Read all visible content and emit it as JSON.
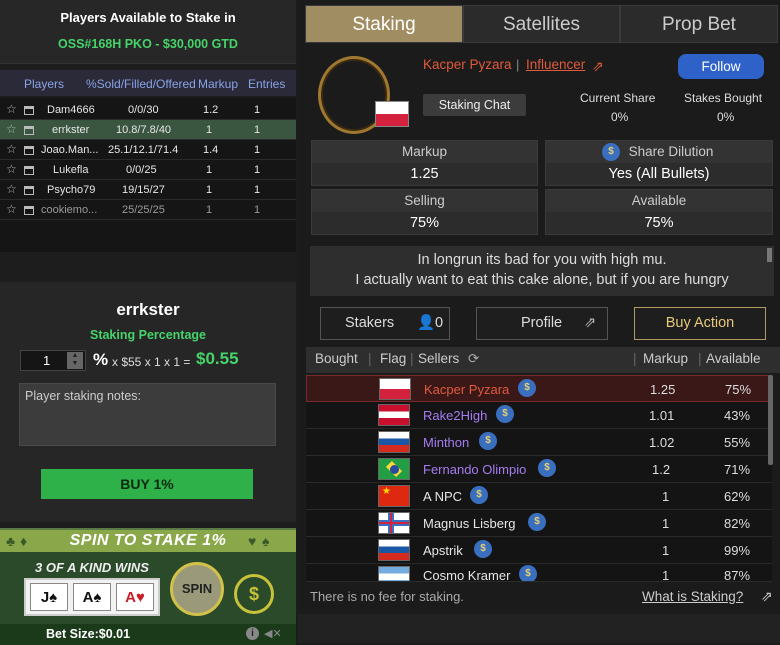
{
  "left_panel": {
    "title": "Players Available to Stake in",
    "subtitle": "OSS#168H PKO - $30,000 GTD",
    "columns": [
      "Players",
      "%Sold/Filled/Offered",
      "Markup",
      "Entries"
    ],
    "rows": [
      {
        "player": "Dam4666",
        "sold": "0/0/30",
        "markup": "1.2",
        "entries": "1"
      },
      {
        "player": "errkster",
        "sold": "10.8/7.8/40",
        "markup": "1",
        "entries": "1"
      },
      {
        "player": "Joao.Man...",
        "sold": "25.1/12.1/71.4",
        "markup": "1.4",
        "entries": "1"
      },
      {
        "player": "Lukefla",
        "sold": "0/0/25",
        "markup": "1",
        "entries": "1"
      },
      {
        "player": "Psycho79",
        "sold": "19/15/27",
        "markup": "1",
        "entries": "1"
      },
      {
        "player": "cookiemo...",
        "sold": "25/25/25",
        "markup": "1",
        "entries": "1"
      }
    ],
    "selected_player": "errkster",
    "staking_percentage_label": "Staking Percentage",
    "quantity": "1",
    "percent_sign": "%",
    "calc": "x $55 x 1 x 1 =",
    "total": "$0.55",
    "notes_placeholder": "Player staking notes:",
    "buy_label": "BUY 1%"
  },
  "promo": {
    "title": "SPIN TO STAKE 1%",
    "subtitle": "3 OF A KIND WINS",
    "cards": [
      "J♠",
      "A♠",
      "A♥"
    ],
    "spin_label": "SPIN",
    "coin_symbol": "$",
    "bet_size": "Bet Size:$0.01"
  },
  "tabs": [
    "Staking",
    "Satellites",
    "Prop Bet"
  ],
  "profile": {
    "name": "Kacper Pyzara",
    "separator": "|",
    "influencer_label": "Influencer",
    "follow_label": "Follow",
    "chat_label": "Staking Chat",
    "current_share_label": "Current Share",
    "current_share_value": "0%",
    "stakes_bought_label": "Stakes Bought",
    "stakes_bought_value": "0%"
  },
  "stats": {
    "markup_label": "Markup",
    "markup_value": "1.25",
    "dilution_label": "Share Dilution",
    "dilution_value": "Yes (All Bullets)",
    "selling_label": "Selling",
    "selling_value": "75%",
    "available_label": "Available",
    "available_value": "75%"
  },
  "message": {
    "line1": "In longrun its bad for you with high mu.",
    "line2": "I actually want to eat this cake alone, but if you are hungry"
  },
  "actions": {
    "stakers_label": "Stakers",
    "stakers_count": "0",
    "profile_label": "Profile",
    "buy_action_label": "Buy Action"
  },
  "list": {
    "columns": [
      "Bought",
      "Flag",
      "Sellers",
      "Markup",
      "Available"
    ],
    "rows": [
      {
        "seller": "Kacper Pyzara",
        "markup": "1.25",
        "available": "75%",
        "name_color": "#e05a3c"
      },
      {
        "seller": "Rake2High",
        "markup": "1.01",
        "available": "43%",
        "name_color": "#a57cf0"
      },
      {
        "seller": "Minthon",
        "markup": "1.02",
        "available": "55%",
        "name_color": "#a57cf0"
      },
      {
        "seller": "Fernando Olimpio",
        "markup": "1.2",
        "available": "71%",
        "name_color": "#a57cf0"
      },
      {
        "seller": "A NPC",
        "markup": "1",
        "available": "62%",
        "name_color": "#e6e6e6"
      },
      {
        "seller": "Magnus Lisberg",
        "markup": "1",
        "available": "82%",
        "name_color": "#e6e6e6"
      },
      {
        "seller": "Apstrik",
        "markup": "1",
        "available": "99%",
        "name_color": "#e6e6e6"
      },
      {
        "seller": "Cosmo Kramer",
        "markup": "1",
        "available": "87%",
        "name_color": "#e6e6e6"
      }
    ]
  },
  "footer": {
    "fee_text": "There is no fee for staking.",
    "what_link": "What is Staking?"
  },
  "colors": {
    "accent_green": "#46d36a",
    "tab_active": "#a18d62",
    "follow_blue": "#2e62c9",
    "influencer": "#e05a3c"
  }
}
